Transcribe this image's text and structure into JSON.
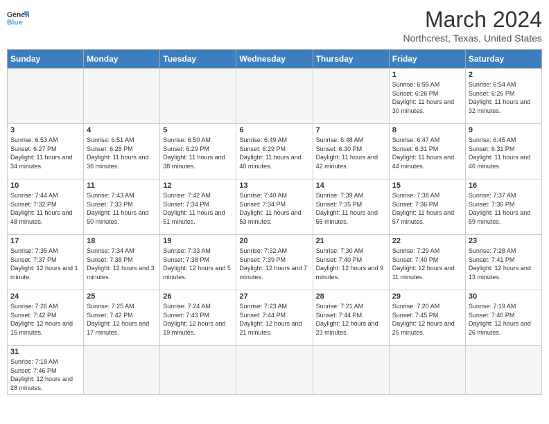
{
  "header": {
    "logo_general": "General",
    "logo_blue": "Blue",
    "title": "March 2024",
    "subtitle": "Northcrest, Texas, United States"
  },
  "weekdays": [
    "Sunday",
    "Monday",
    "Tuesday",
    "Wednesday",
    "Thursday",
    "Friday",
    "Saturday"
  ],
  "weeks": [
    [
      {
        "day": "",
        "empty": true
      },
      {
        "day": "",
        "empty": true
      },
      {
        "day": "",
        "empty": true
      },
      {
        "day": "",
        "empty": true
      },
      {
        "day": "",
        "empty": true
      },
      {
        "day": "1",
        "sunrise": "6:55 AM",
        "sunset": "6:26 PM",
        "daylight": "11 hours and 30 minutes."
      },
      {
        "day": "2",
        "sunrise": "6:54 AM",
        "sunset": "6:26 PM",
        "daylight": "11 hours and 32 minutes."
      }
    ],
    [
      {
        "day": "3",
        "sunrise": "6:53 AM",
        "sunset": "6:27 PM",
        "daylight": "11 hours and 34 minutes."
      },
      {
        "day": "4",
        "sunrise": "6:51 AM",
        "sunset": "6:28 PM",
        "daylight": "11 hours and 36 minutes."
      },
      {
        "day": "5",
        "sunrise": "6:50 AM",
        "sunset": "6:29 PM",
        "daylight": "11 hours and 38 minutes."
      },
      {
        "day": "6",
        "sunrise": "6:49 AM",
        "sunset": "6:29 PM",
        "daylight": "11 hours and 40 minutes."
      },
      {
        "day": "7",
        "sunrise": "6:48 AM",
        "sunset": "6:30 PM",
        "daylight": "11 hours and 42 minutes."
      },
      {
        "day": "8",
        "sunrise": "6:47 AM",
        "sunset": "6:31 PM",
        "daylight": "11 hours and 44 minutes."
      },
      {
        "day": "9",
        "sunrise": "6:45 AM",
        "sunset": "6:31 PM",
        "daylight": "11 hours and 46 minutes."
      }
    ],
    [
      {
        "day": "10",
        "sunrise": "7:44 AM",
        "sunset": "7:32 PM",
        "daylight": "11 hours and 48 minutes."
      },
      {
        "day": "11",
        "sunrise": "7:43 AM",
        "sunset": "7:33 PM",
        "daylight": "11 hours and 50 minutes."
      },
      {
        "day": "12",
        "sunrise": "7:42 AM",
        "sunset": "7:34 PM",
        "daylight": "11 hours and 51 minutes."
      },
      {
        "day": "13",
        "sunrise": "7:40 AM",
        "sunset": "7:34 PM",
        "daylight": "11 hours and 53 minutes."
      },
      {
        "day": "14",
        "sunrise": "7:39 AM",
        "sunset": "7:35 PM",
        "daylight": "11 hours and 55 minutes."
      },
      {
        "day": "15",
        "sunrise": "7:38 AM",
        "sunset": "7:36 PM",
        "daylight": "11 hours and 57 minutes."
      },
      {
        "day": "16",
        "sunrise": "7:37 AM",
        "sunset": "7:36 PM",
        "daylight": "11 hours and 59 minutes."
      }
    ],
    [
      {
        "day": "17",
        "sunrise": "7:35 AM",
        "sunset": "7:37 PM",
        "daylight": "12 hours and 1 minute."
      },
      {
        "day": "18",
        "sunrise": "7:34 AM",
        "sunset": "7:38 PM",
        "daylight": "12 hours and 3 minutes."
      },
      {
        "day": "19",
        "sunrise": "7:33 AM",
        "sunset": "7:38 PM",
        "daylight": "12 hours and 5 minutes."
      },
      {
        "day": "20",
        "sunrise": "7:32 AM",
        "sunset": "7:39 PM",
        "daylight": "12 hours and 7 minutes."
      },
      {
        "day": "21",
        "sunrise": "7:30 AM",
        "sunset": "7:40 PM",
        "daylight": "12 hours and 9 minutes."
      },
      {
        "day": "22",
        "sunrise": "7:29 AM",
        "sunset": "7:40 PM",
        "daylight": "12 hours and 11 minutes."
      },
      {
        "day": "23",
        "sunrise": "7:28 AM",
        "sunset": "7:41 PM",
        "daylight": "12 hours and 13 minutes."
      }
    ],
    [
      {
        "day": "24",
        "sunrise": "7:26 AM",
        "sunset": "7:42 PM",
        "daylight": "12 hours and 15 minutes."
      },
      {
        "day": "25",
        "sunrise": "7:25 AM",
        "sunset": "7:42 PM",
        "daylight": "12 hours and 17 minutes."
      },
      {
        "day": "26",
        "sunrise": "7:24 AM",
        "sunset": "7:43 PM",
        "daylight": "12 hours and 19 minutes."
      },
      {
        "day": "27",
        "sunrise": "7:23 AM",
        "sunset": "7:44 PM",
        "daylight": "12 hours and 21 minutes."
      },
      {
        "day": "28",
        "sunrise": "7:21 AM",
        "sunset": "7:44 PM",
        "daylight": "12 hours and 23 minutes."
      },
      {
        "day": "29",
        "sunrise": "7:20 AM",
        "sunset": "7:45 PM",
        "daylight": "12 hours and 25 minutes."
      },
      {
        "day": "30",
        "sunrise": "7:19 AM",
        "sunset": "7:46 PM",
        "daylight": "12 hours and 26 minutes."
      }
    ],
    [
      {
        "day": "31",
        "sunrise": "7:18 AM",
        "sunset": "7:46 PM",
        "daylight": "12 hours and 28 minutes."
      },
      {
        "day": "",
        "empty": true
      },
      {
        "day": "",
        "empty": true
      },
      {
        "day": "",
        "empty": true
      },
      {
        "day": "",
        "empty": true
      },
      {
        "day": "",
        "empty": true
      },
      {
        "day": "",
        "empty": true
      }
    ]
  ]
}
